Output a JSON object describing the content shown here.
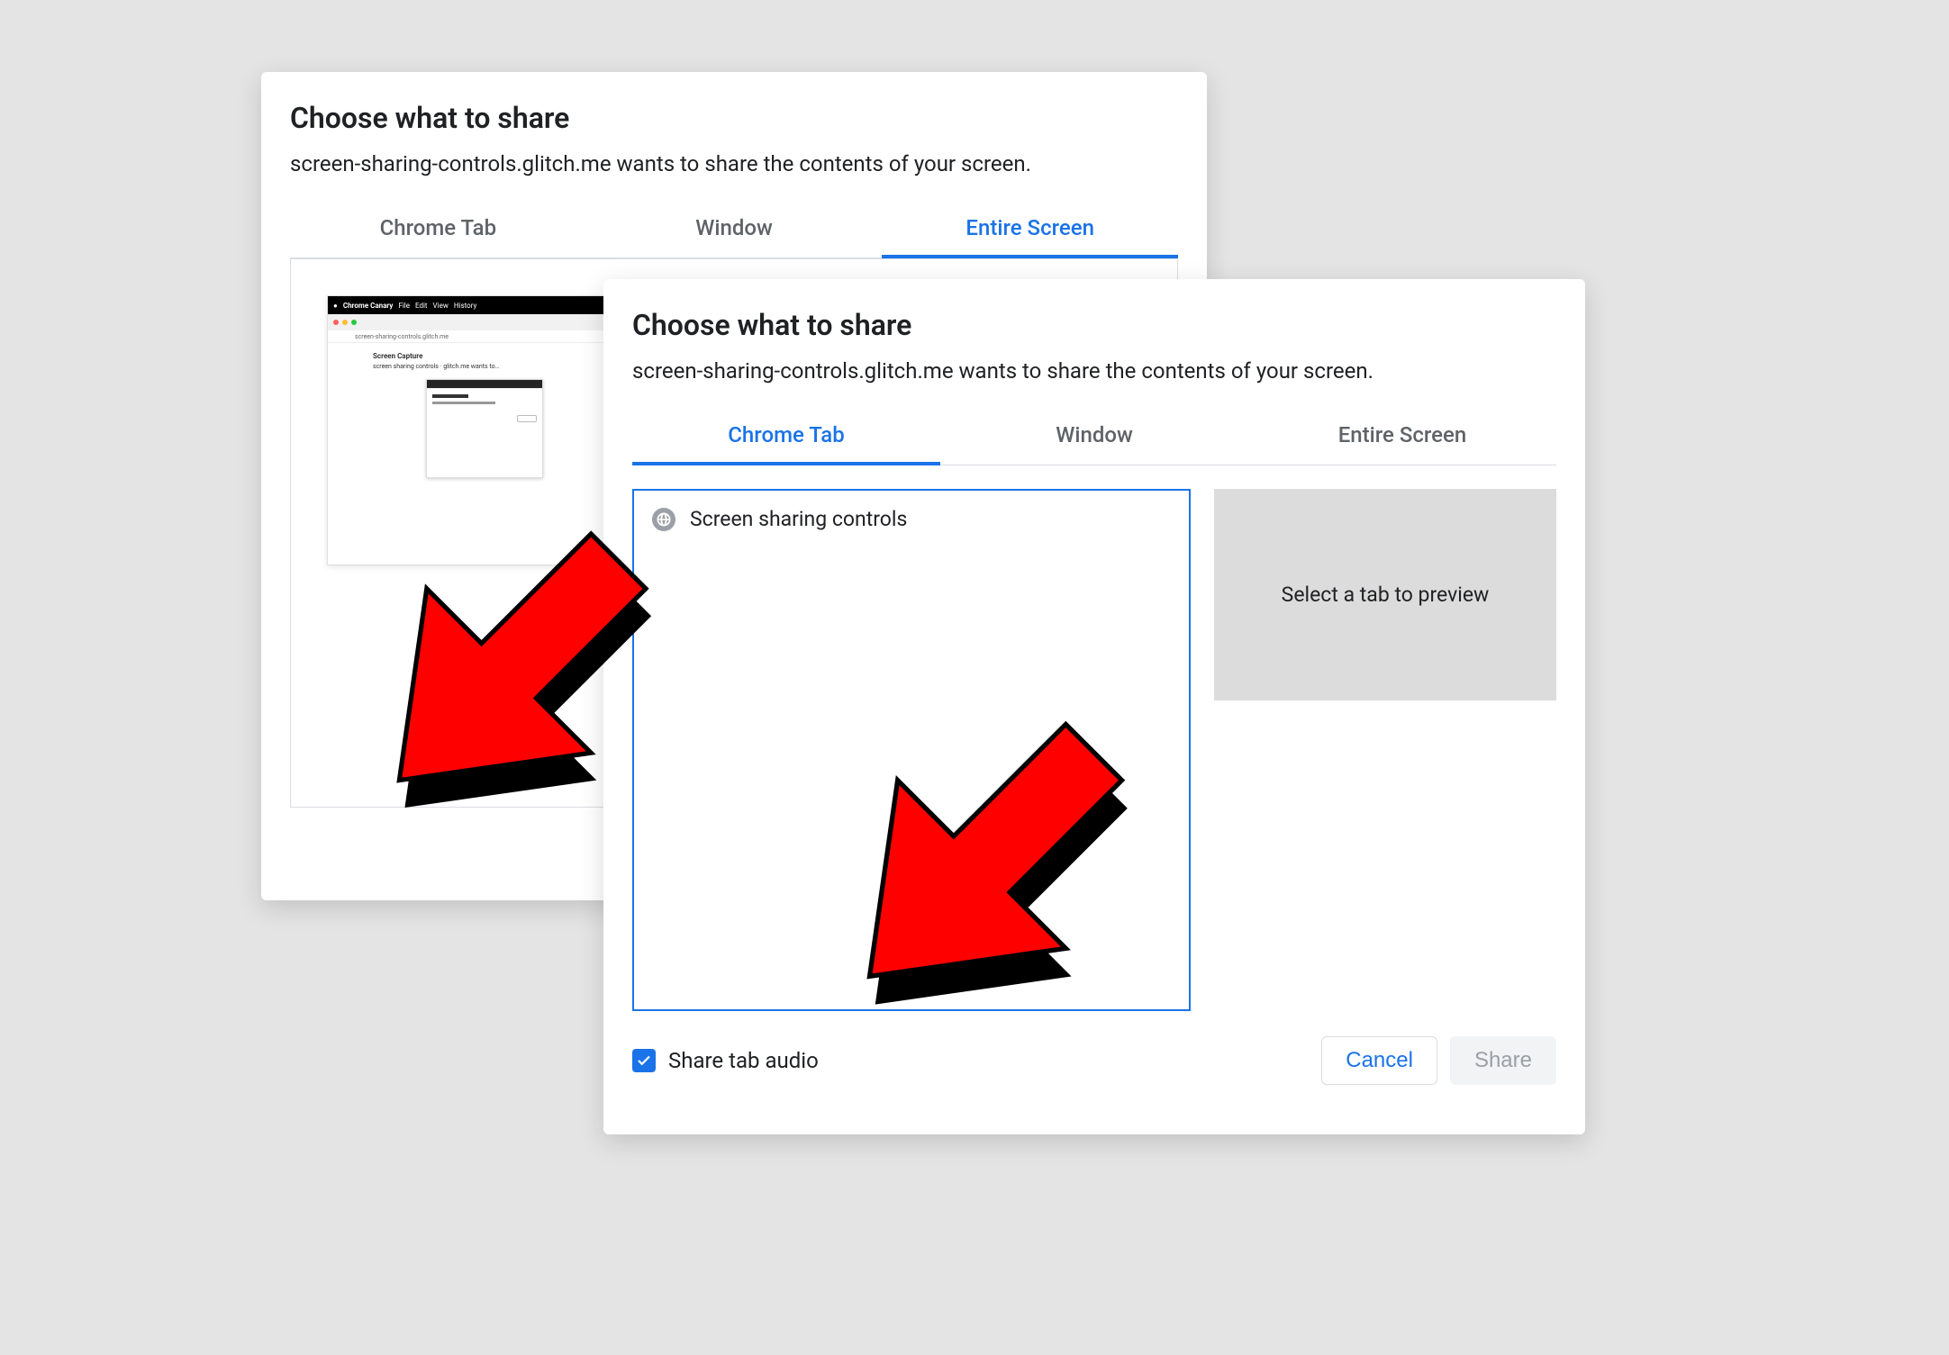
{
  "dialog_back": {
    "title": "Choose what to share",
    "subtitle": "screen-sharing-controls.glitch.me wants to share the contents of your screen.",
    "tabs": [
      "Chrome Tab",
      "Window",
      "Entire Screen"
    ],
    "active_tab_index": 2
  },
  "dialog_front": {
    "title": "Choose what to share",
    "subtitle": "screen-sharing-controls.glitch.me wants to share the contents of your screen.",
    "tabs": [
      "Chrome Tab",
      "Window",
      "Entire Screen"
    ],
    "active_tab_index": 0,
    "tab_items": [
      {
        "label": "Screen sharing controls"
      }
    ],
    "preview_placeholder": "Select a tab to preview",
    "share_audio_label": "Share tab audio",
    "share_audio_checked": true,
    "cancel_label": "Cancel",
    "share_label": "Share"
  },
  "colors": {
    "accent": "#1a73e8",
    "arrow_fill": "#ff0000",
    "arrow_shadow": "#000000"
  }
}
